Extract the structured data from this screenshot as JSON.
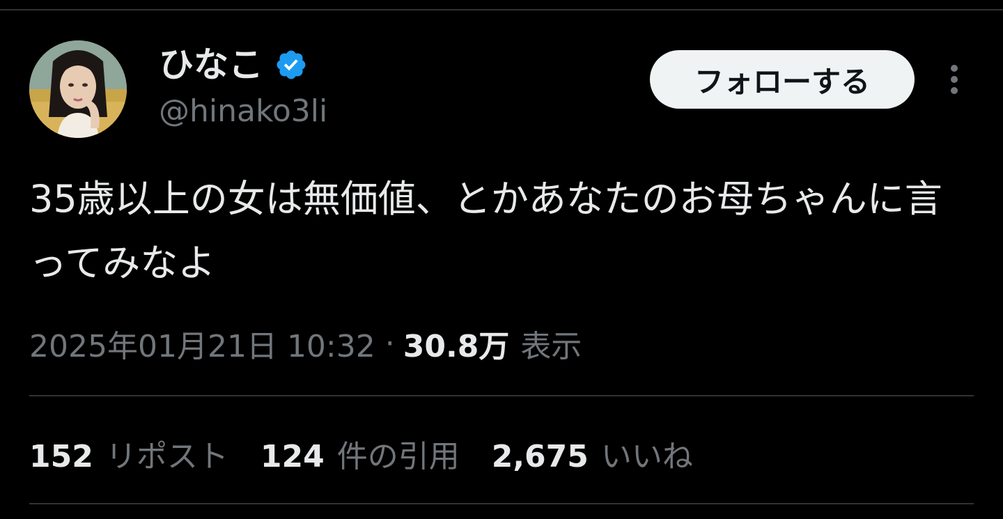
{
  "user": {
    "display_name": "ひなこ",
    "handle": "@hinako3li",
    "verified_icon": "verified-badge-icon",
    "avatar": "avatar-portrait"
  },
  "actions": {
    "follow_label": "フォローする",
    "more_icon": "more-vertical-icon"
  },
  "tweet": {
    "text": "35歳以上の女は無価値、とかあなたのお母ちゃんに言ってみなよ"
  },
  "meta": {
    "datetime": "2025年01月21日 10:32",
    "separator": "·",
    "views_count": "30.8万",
    "views_label": "表示"
  },
  "stats": [
    {
      "count": "152",
      "label": "リポスト"
    },
    {
      "count": "124",
      "label": "件の引用"
    },
    {
      "count": "2,675",
      "label": "いいね"
    }
  ],
  "colors": {
    "background": "#000000",
    "text_primary": "#e7e9ea",
    "text_secondary": "#71767b",
    "divider": "#2f3336",
    "verified": "#1d9bf0",
    "follow_bg": "#eff3f4"
  }
}
